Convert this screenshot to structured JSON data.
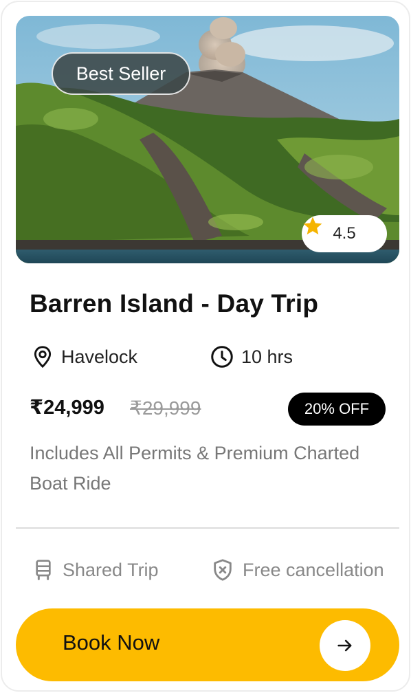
{
  "card": {
    "badge": "Best Seller",
    "rating": "4.5",
    "title": "Barren Island - Day Trip",
    "location": "Havelock",
    "duration": "10 hrs",
    "price": "₹24,999",
    "old_price": "₹29,999",
    "discount": "20% OFF",
    "description": "Includes All Permits & Premium Charted Boat Ride",
    "features": {
      "shared": "Shared Trip",
      "cancellation": "Free cancellation"
    },
    "cta": "Book Now"
  },
  "icons": {
    "rating": "star-icon",
    "location": "location-pin-icon",
    "duration": "clock-icon",
    "shared": "bus-icon",
    "cancellation": "shield-x-icon",
    "cta": "arrow-right-icon"
  },
  "colors": {
    "accent": "#fdbb00",
    "star": "#f5b400",
    "discount_bg": "#000000"
  }
}
